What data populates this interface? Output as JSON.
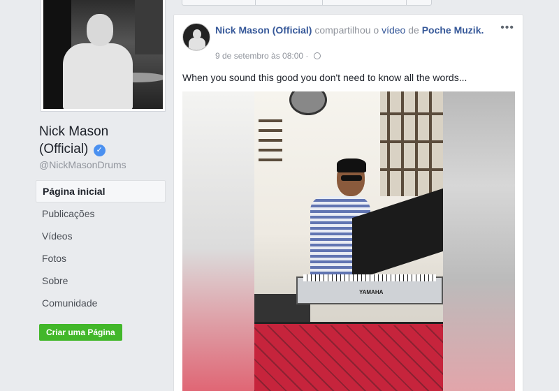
{
  "page": {
    "name": "Nick Mason (Official)",
    "name_line1": "Nick Mason",
    "name_line2": "(Official)",
    "handle": "@NickMasonDrums",
    "verified_glyph": "✓"
  },
  "nav": {
    "items": [
      {
        "label": "Página inicial",
        "active": true
      },
      {
        "label": "Publicações"
      },
      {
        "label": "Vídeos"
      },
      {
        "label": "Fotos"
      },
      {
        "label": "Sobre"
      },
      {
        "label": "Comunidade"
      }
    ],
    "create_page_label": "Criar uma Página"
  },
  "post": {
    "author": "Nick Mason (Official)",
    "action": "compartilhou o",
    "object": "vídeo",
    "preposition": "de",
    "source": "Poche Muzik.",
    "timestamp": "9 de setembro às 08:00 ·",
    "more_glyph": "•••",
    "text": "When you sound this good you don't need to know all the words..."
  },
  "video": {
    "brand_label": "YAMAHA"
  },
  "icons": {
    "verified": "verified-badge-icon",
    "globe": "globe-icon",
    "more": "more-options-icon"
  },
  "colors": {
    "link": "#365899",
    "create_button": "#42b72a",
    "verified": "#4a90f0",
    "background": "#e9ebee"
  }
}
